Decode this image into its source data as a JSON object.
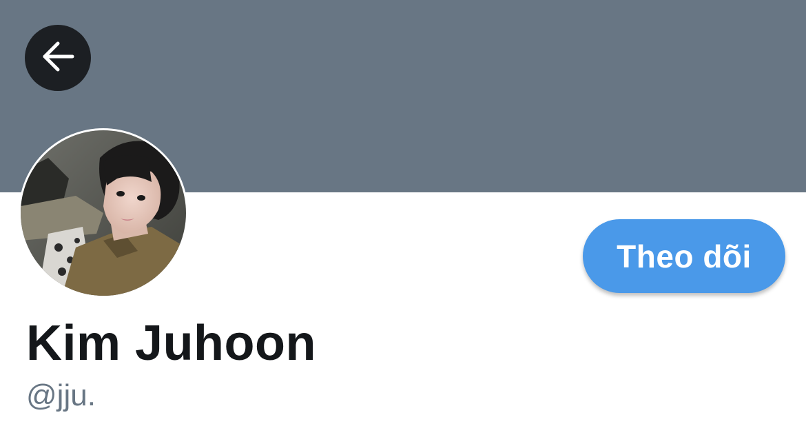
{
  "header": {
    "banner_color": "#687684",
    "back_icon": "arrow-left-icon"
  },
  "profile": {
    "avatar_description": "profile-photo",
    "display_name": "Kim Juhoon",
    "handle": "@jju."
  },
  "actions": {
    "follow_label": "Theo dõi",
    "follow_color": "#4a99e9"
  }
}
